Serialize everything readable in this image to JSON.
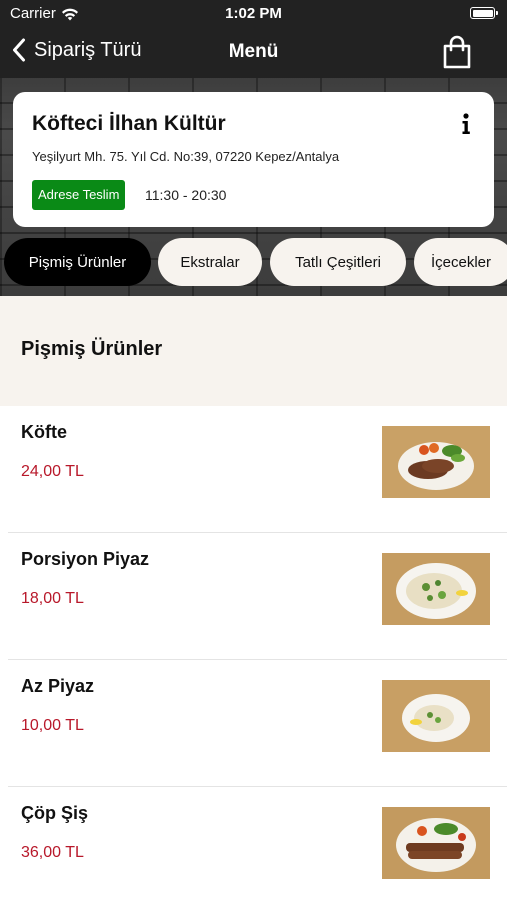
{
  "status_bar": {
    "carrier": "Carrier",
    "time": "1:02 PM"
  },
  "nav": {
    "back_label": "Sipariş Türü",
    "title": "Menü",
    "cart_icon": "shopping-bag-icon"
  },
  "store": {
    "name": "Köfteci İlhan Kültür",
    "address": "Yeşilyurt Mh. 75. Yıl Cd. No:39, 07220 Kepez/Antalya",
    "delivery_badge": "Adrese Teslim",
    "hours": "11:30 - 20:30",
    "badge_color": "#0a8a16",
    "info_icon": "info-icon"
  },
  "tabs": [
    {
      "label": "Pişmiş Ürünler",
      "active": true
    },
    {
      "label": "Ekstralar",
      "active": false
    },
    {
      "label": "Tatlı Çeşitleri",
      "active": false
    },
    {
      "label": "İçecekler",
      "active": false
    }
  ],
  "section": {
    "title": "Pişmiş Ürünler"
  },
  "items": [
    {
      "name": "Köfte",
      "price": "24,00 TL",
      "image": "kofte-plate-photo"
    },
    {
      "name": "Porsiyon Piyaz",
      "price": "18,00 TL",
      "image": "piyaz-plate-photo"
    },
    {
      "name": "Az Piyaz",
      "price": "10,00 TL",
      "image": "small-piyaz-plate-photo"
    },
    {
      "name": "Çöp Şiş",
      "price": "36,00 TL",
      "image": "cop-sis-plate-photo"
    }
  ],
  "colors": {
    "price": "#b8182a",
    "active_tab": "#000000",
    "section_bg": "#f7f3ee"
  }
}
